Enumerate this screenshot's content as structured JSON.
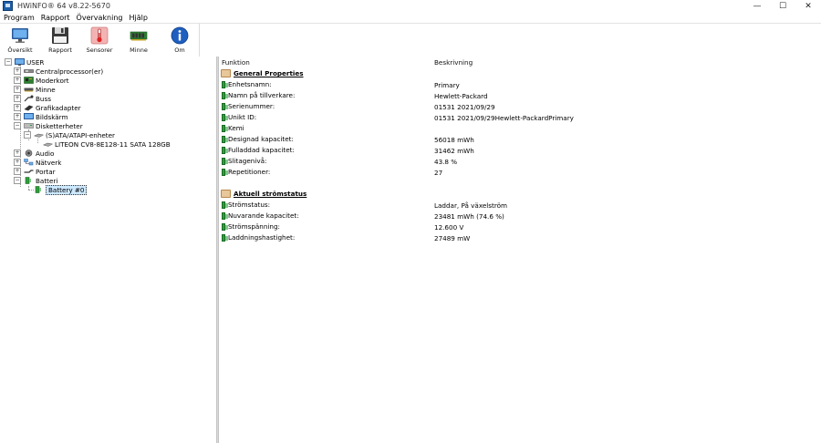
{
  "window": {
    "title": "HWiNFO® 64 v8.22-5670",
    "controls": [
      "—",
      "☐",
      "✕"
    ]
  },
  "menu": [
    "Program",
    "Rapport",
    "Övervakning",
    "Hjälp"
  ],
  "toolbar": [
    {
      "label": "Översikt",
      "icon": "monitor-icon"
    },
    {
      "label": "Rapport",
      "icon": "floppy-icon"
    },
    {
      "label": "Sensorer",
      "icon": "thermometer-icon"
    },
    {
      "label": "Minne",
      "icon": "memory-chip-icon"
    },
    {
      "label": "Om",
      "icon": "info-icon"
    }
  ],
  "tree": {
    "root": "USER",
    "items": [
      {
        "label": "Centralprocessor(er)",
        "icon": "cpu-icon"
      },
      {
        "label": "Moderkort",
        "icon": "motherboard-icon"
      },
      {
        "label": "Minne",
        "icon": "memory-icon"
      },
      {
        "label": "Buss",
        "icon": "bus-icon"
      },
      {
        "label": "Grafikadapter",
        "icon": "gpu-icon"
      },
      {
        "label": "Bildskärm",
        "icon": "display-icon"
      },
      {
        "label": "Disketterheter",
        "icon": "drive-icon"
      },
      {
        "label": "(S)ATA/ATAPI-enheter",
        "icon": "disk-icon"
      },
      {
        "label": "LITEON CV8-8E128-11 SATA 128GB",
        "icon": "disk-icon"
      },
      {
        "label": "Audio",
        "icon": "speaker-icon"
      },
      {
        "label": "Nätverk",
        "icon": "network-icon"
      },
      {
        "label": "Portar",
        "icon": "port-icon"
      },
      {
        "label": "Batteri",
        "icon": "battery-icon"
      },
      {
        "label": "Battery #0",
        "icon": "battery-icon",
        "selected": true
      }
    ]
  },
  "table": {
    "col_function": "Funktion",
    "col_description": "Beskrivning",
    "sections": [
      {
        "title": "General Properties",
        "rows": [
          {
            "name": "Enhetsnamn:",
            "value": "Primary"
          },
          {
            "name": "Namn på tillverkare:",
            "value": "Hewlett-Packard"
          },
          {
            "name": "Serienummer:",
            "value": "01531 2021/09/29"
          },
          {
            "name": "Unikt ID:",
            "value": "01531 2021/09/29Hewlett-PackardPrimary"
          },
          {
            "name": "Kemi",
            "value": ""
          },
          {
            "name": "Designad kapacitet:",
            "value": "56018 mWh"
          },
          {
            "name": "Fulladdad kapacitet:",
            "value": "31462 mWh"
          },
          {
            "name": "Slitagenivå:",
            "value": "43.8 %"
          },
          {
            "name": "Repetitioner:",
            "value": "27"
          }
        ]
      },
      {
        "title": "Aktuell strömstatus",
        "rows": [
          {
            "name": "Strömstatus:",
            "value": "Laddar, På växelström"
          },
          {
            "name": "Nuvarande kapacitet:",
            "value": "23481 mWh (74.6 %)"
          },
          {
            "name": "Strömspänning:",
            "value": "12.600 V"
          },
          {
            "name": "Laddningshastighet:",
            "value": "27489 mW"
          }
        ]
      }
    ]
  }
}
